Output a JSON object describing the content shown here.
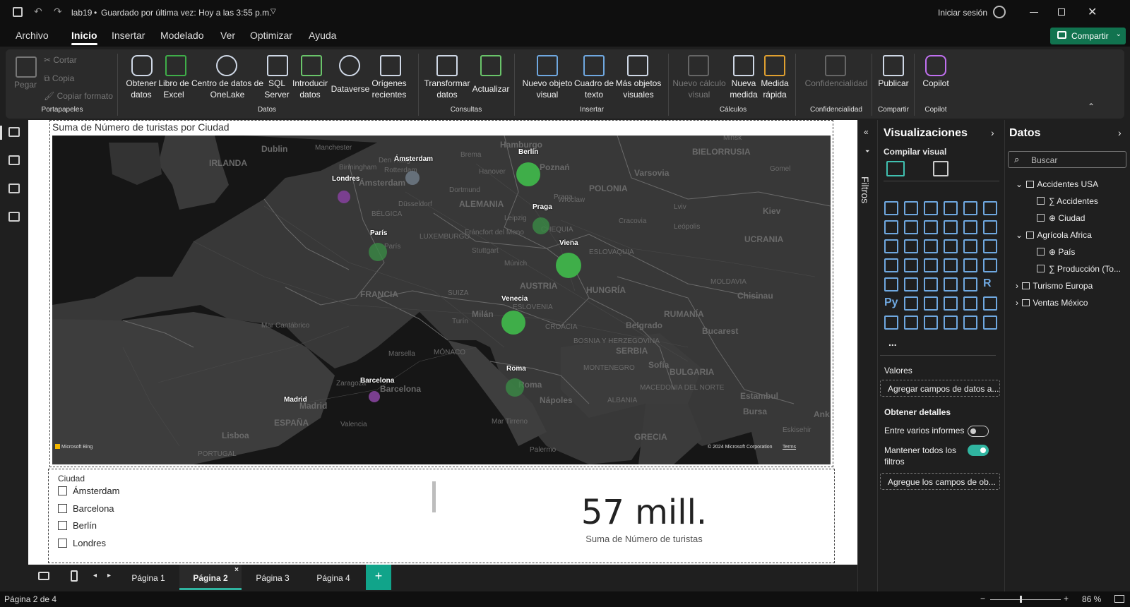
{
  "titlebar": {
    "doc_title": "lab19",
    "saved": "Guardado por última vez: Hoy a las 3:55 p.m.",
    "signin": "Iniciar sesión"
  },
  "menus": [
    "Archivo",
    "Inicio",
    "Insertar",
    "Modelado",
    "Ver",
    "Optimizar",
    "Ayuda"
  ],
  "share_label": "Compartir",
  "ribbon": {
    "clipboard": {
      "paste": "Pegar",
      "cut": "Cortar",
      "copy": "Copia",
      "format": "Copiar formato",
      "group": "Portapapeles"
    },
    "data": {
      "get": "Obtener datos",
      "excel": "Libro de Excel",
      "onelake": "Centro de datos de OneLake",
      "sql": "SQL Server",
      "enter": "Introducir datos",
      "dataverse": "Dataverse",
      "recent": "Orígenes recientes",
      "group": "Datos"
    },
    "queries": {
      "transform": "Transformar datos",
      "refresh": "Actualizar",
      "group": "Consultas"
    },
    "insert": {
      "visual": "Nuevo objeto visual",
      "textbox": "Cuadro de texto",
      "more": "Más objetos visuales",
      "group": "Insertar"
    },
    "calcs": {
      "visualcalc": "Nuevo cálculo visual",
      "measure": "Nueva medida",
      "quick": "Medida rápida",
      "group": "Cálculos"
    },
    "sensitivity": {
      "label": "Confidencialidad",
      "group": "Confidencialidad"
    },
    "share": {
      "publish": "Publicar",
      "group": "Compartir"
    },
    "copilot": {
      "label": "Copilot",
      "group": "Copilot"
    }
  },
  "map": {
    "title": "Suma de Número de turistas por Ciudad",
    "cities": [
      {
        "name": "Berlín"
      },
      {
        "name": "Ámsterdam"
      },
      {
        "name": "Londres"
      },
      {
        "name": "Praga"
      },
      {
        "name": "París"
      },
      {
        "name": "Viena"
      },
      {
        "name": "Venecia"
      },
      {
        "name": "Roma"
      },
      {
        "name": "Barcelona"
      },
      {
        "name": "Madrid"
      }
    ],
    "geo_labels": [
      "Dublin",
      "IRLANDA",
      "Manchester",
      "Birmingham",
      "Hamburgo",
      "Brema",
      "Hanover",
      "Dortmund",
      "Ámsterdam",
      "Londres",
      "Berlín",
      "Poznań",
      "Varsovia",
      "BIELORRUSIA",
      "Minsk",
      "Gomel",
      "POLONIA",
      "Wroclaw",
      "Kiev",
      "ALEMANIA",
      "BÉLGICA",
      "Leipzig",
      "Praga",
      "Cracovia",
      "Lviv",
      "Leópolis",
      "UCRANIA",
      "París",
      "Fráncfort del Meno",
      "Stuttgart",
      "CHEQUIA",
      "ESLOVAQUIA",
      "Viena",
      "Múnich",
      "FRANCIA",
      "AUSTRIA",
      "HUNGRÍA",
      "MOLDAVIA",
      "Chisinau",
      "SUIZA",
      "ESLOVENIA",
      "Milán",
      "Turín",
      "CROACIA",
      "Belgrado",
      "RUMANÍA",
      "Bucarest",
      "Mar Cantábrico",
      "MÓNACO",
      "BOSNIA Y HERZEGOVINA",
      "SERBIA",
      "Marsella",
      "Zaragoza",
      "Barcelona",
      "Roma",
      "MONTENEGRO",
      "BULGARIA",
      "Sofía",
      "Estambul",
      "Bursa",
      "Madrid",
      "ESPAÑA",
      "Valencia",
      "Nápoles",
      "MACEDONIA DEL NORTE",
      "ALBANIA",
      "Eskisehir",
      "Mar Tirreno",
      "Lisboa",
      "PORTUGAL",
      "Palermo",
      "GRECIA",
      "Ank",
      "LUXEMBURGO",
      "Düsseldorf",
      "Rotterdam",
      "Den Haag"
    ],
    "attribution": "Microsoft Bing",
    "copyright": "© 2024 Microsoft Corporation",
    "terms": "Terms"
  },
  "slicer": {
    "title": "Ciudad",
    "items": [
      "Ámsterdam",
      "Barcelona",
      "Berlín",
      "Londres"
    ]
  },
  "kpi": {
    "value": "57 mill.",
    "label": "Suma de Número de turistas"
  },
  "filters_label": "Filtros",
  "viz": {
    "title": "Visualizaciones",
    "build": "Compilar visual",
    "values": "Valores",
    "values_drop": "Agregar campos de datos a...",
    "drill": "Obtener detalles",
    "cross": "Entre varios informes",
    "keep": "Mantener todos los filtros",
    "drill_drop": "Agregue los campos de ob...",
    "more": "..."
  },
  "data": {
    "title": "Datos",
    "search_placeholder": "Buscar",
    "tables": [
      {
        "name": "Accidentes USA",
        "fields": [
          "Accidentes",
          "Ciudad"
        ]
      },
      {
        "name": "Agrícola Africa",
        "fields": [
          "País",
          "Producción (To..."
        ]
      },
      {
        "name": "Turismo Europa",
        "fields": []
      },
      {
        "name": "Ventas México",
        "fields": []
      }
    ]
  },
  "pages": [
    "Página 1",
    "Página 2",
    "Página 3",
    "Página 4"
  ],
  "status": {
    "page": "Página 2 de 4",
    "zoom": "86 %"
  },
  "colors": {
    "accent": "#11734f",
    "bubble_green": "#3fae49",
    "bubble_purple": "#7a3f8f",
    "bubble_grey": "#6f7a86"
  }
}
